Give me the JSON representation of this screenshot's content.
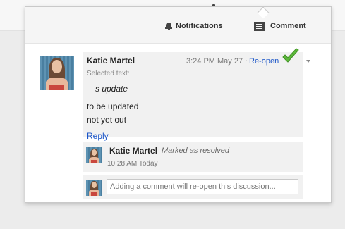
{
  "header": {
    "notifications_label": "Notifications",
    "comment_label": "Comment"
  },
  "thread": {
    "author": "Katie Martel",
    "timestamp": "3:24 PM May 27",
    "separator": "·",
    "reopen_label": "Re-open",
    "selected_text_label": "Selected text:",
    "selected_text": "s update",
    "comment_lines": [
      "to be updated",
      "not yet out"
    ],
    "reply_label": "Reply"
  },
  "resolved_reply": {
    "author": "Katie Martel",
    "status": "Marked as resolved",
    "timestamp": "10:28 AM Today"
  },
  "new_comment": {
    "placeholder": "Adding a comment will re-open this discussion..."
  },
  "colors": {
    "link": "#1a55c8",
    "resolved_check": "#5cb83a",
    "thread_bg": "#f1f1f1"
  },
  "icons": [
    "bell-icon",
    "comment-icon",
    "checkmark-icon",
    "dropdown-arrow-icon"
  ]
}
